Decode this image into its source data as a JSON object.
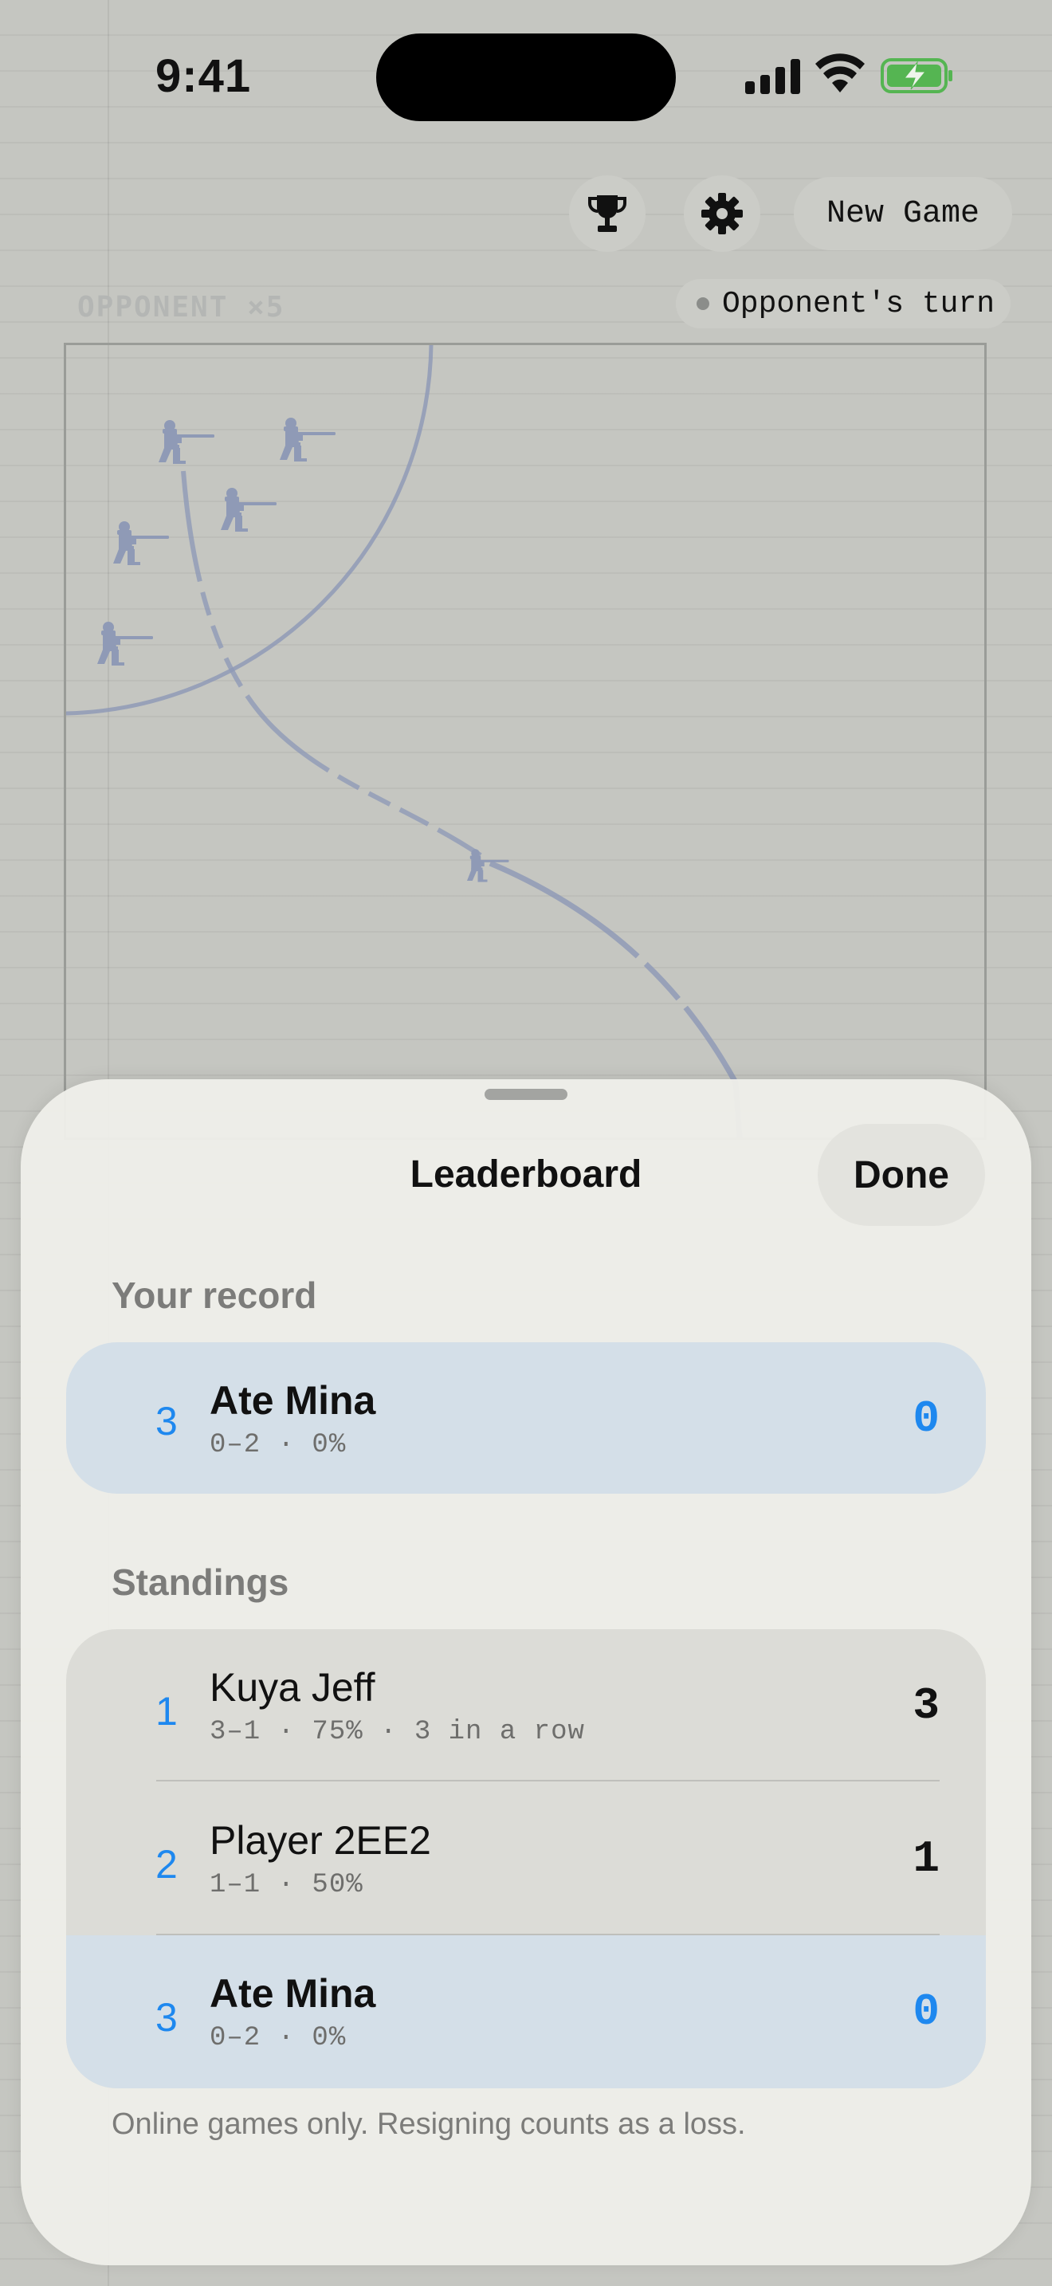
{
  "status_bar": {
    "time": "9:41"
  },
  "toolbar": {
    "trophy_icon": "trophy-icon",
    "settings_icon": "gear-icon",
    "new_game_label": "New Game"
  },
  "game": {
    "opponent_label": "OPPONENT ×5",
    "turn_status": "Opponent's turn"
  },
  "leaderboard": {
    "title": "Leaderboard",
    "done_label": "Done",
    "your_record_header": "Your record",
    "your_record": {
      "rank": "3",
      "name": "Ate Mina",
      "stats": "0–2 · 0%",
      "score": "0"
    },
    "standings_header": "Standings",
    "standings": [
      {
        "rank": "1",
        "name": "Kuya Jeff",
        "stats": "3–1 · 75% · 3 in a row",
        "score": "3",
        "is_you": false
      },
      {
        "rank": "2",
        "name": "Player 2EE2",
        "stats": "1–1 · 50%",
        "score": "1",
        "is_you": false
      },
      {
        "rank": "3",
        "name": "Ate Mina",
        "stats": "0–2 · 0%",
        "score": "0",
        "is_you": true
      }
    ],
    "footnote": "Online games only. Resigning counts as a loss."
  },
  "colors": {
    "accent": "#1e88ef",
    "soldier": "#8f9ab6",
    "highlight_row": "#d4dfe8"
  }
}
